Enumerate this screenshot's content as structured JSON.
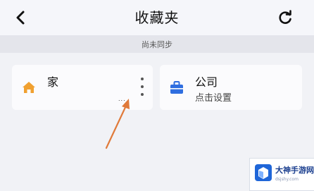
{
  "header": {
    "title": "收藏夹",
    "back_icon": "chevron-left-icon",
    "refresh_icon": "refresh-icon"
  },
  "sync_bar": {
    "text": "尚未同步"
  },
  "favorites": [
    {
      "name": "家",
      "subtitle": "",
      "icon": "home-icon",
      "icon_color": "#f0a030"
    },
    {
      "name": "公司",
      "subtitle": "点击设置",
      "icon": "briefcase-icon",
      "icon_color": "#2f6ee0"
    }
  ],
  "home_card": {
    "ellipsis": "..."
  },
  "annotation": {
    "arrow_color": "#e07a3a"
  },
  "watermark": {
    "brand": "大神手游网",
    "url": "dsjshy.com"
  }
}
